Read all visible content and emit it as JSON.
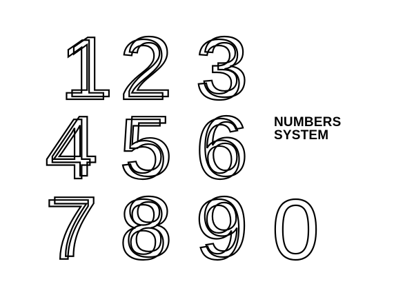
{
  "colors": {
    "ink": "#000000",
    "background": "#ffffff"
  },
  "digits": [
    {
      "glyph": "1"
    },
    {
      "glyph": "2"
    },
    {
      "glyph": "3"
    },
    {
      "glyph": "4"
    },
    {
      "glyph": "5"
    },
    {
      "glyph": "6"
    },
    {
      "glyph": "7"
    },
    {
      "glyph": "8"
    },
    {
      "glyph": "9"
    },
    {
      "glyph": "0"
    }
  ],
  "title": {
    "line1": "NUMBERS",
    "line2": "SYSTEM"
  }
}
